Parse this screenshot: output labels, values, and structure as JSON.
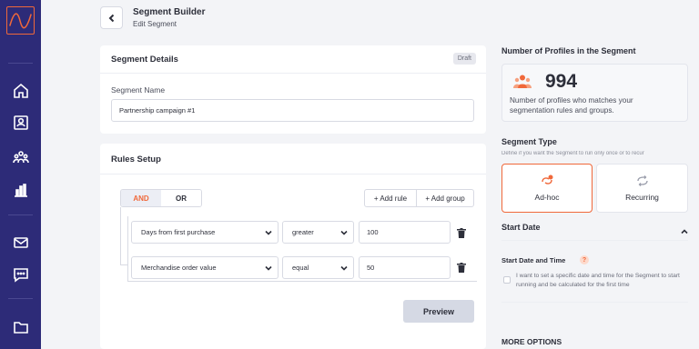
{
  "header": {
    "title": "Segment Builder",
    "subtitle": "Edit Segment"
  },
  "sidebar": {
    "icons": [
      "logo-icon",
      "home-icon",
      "profile-icon",
      "audience-icon",
      "analytics-icon",
      "mail-icon",
      "chat-icon",
      "folder-icon"
    ]
  },
  "segment_details": {
    "title": "Segment Details",
    "status": "Draft",
    "name_label": "Segment Name",
    "name_value": "Partnership campaign #1"
  },
  "rules": {
    "title": "Rules Setup",
    "and_label": "AND",
    "or_label": "OR",
    "selected_operator": "AND",
    "add_rule": "+ Add rule",
    "add_group": "+ Add group",
    "rows": [
      {
        "field": "Days from first purchase",
        "operator": "greater",
        "value": "100"
      },
      {
        "field": "Merchandise order value",
        "operator": "equal",
        "value": "50"
      }
    ],
    "preview": "Preview"
  },
  "profiles": {
    "title": "Number of Profiles in the Segment",
    "count": "994",
    "description": "Number of profiles who matches your segmentation rules and groups."
  },
  "segment_type": {
    "title": "Segment Type",
    "description": "Define if you want the Segment to run only once or to recur",
    "options": [
      "Ad-hoc",
      "Recurring"
    ],
    "selected": "Ad-hoc"
  },
  "start_date": {
    "title": "Start Date",
    "sub_title": "Start Date and Time",
    "help": "?",
    "checkbox_label": "I want to set a specific date and time for the Segment to start running and be calculated for the first time"
  },
  "more_options": "MORE OPTIONS",
  "colors": {
    "sidebar": "#2d2b78",
    "accent": "#f0683a"
  }
}
